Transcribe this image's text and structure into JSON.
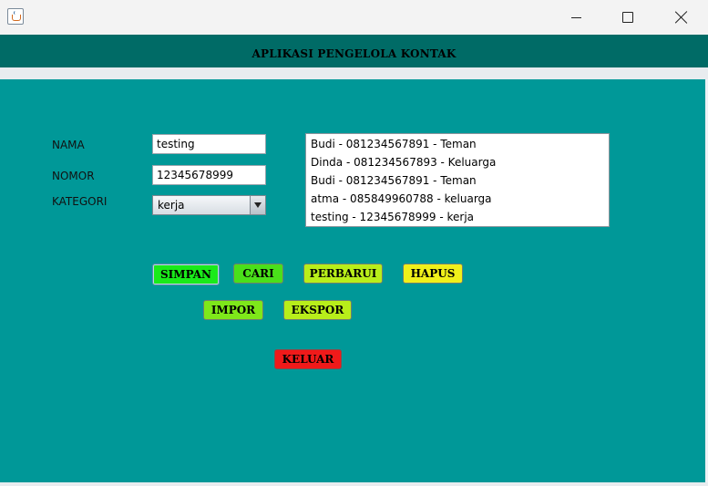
{
  "window": {
    "minimize_icon": "minimize-icon",
    "maximize_icon": "maximize-icon",
    "close_icon": "close-icon",
    "app_icon": "java-cup-icon"
  },
  "header": {
    "title": "APLIKASI PENGELOLA KONTAK"
  },
  "form": {
    "nama_label": "NAMA",
    "nama_value": "testing",
    "nomor_label": "NOMOR",
    "nomor_value": "12345678999",
    "kategori_label": "KATEGORI",
    "kategori_selected": "kerja"
  },
  "contacts": [
    "Budi - 081234567891 - Teman",
    "Dinda - 081234567893 - Keluarga",
    "Budi - 081234567891 - Teman",
    "atma - 085849960788 - keluarga",
    "testing - 12345678999 - kerja"
  ],
  "buttons": {
    "simpan": "SIMPAN",
    "cari": "CARI",
    "perbarui": "PERBARUI",
    "hapus": "HAPUS",
    "impor": "IMPOR",
    "ekspor": "EKSPOR",
    "keluar": "KELUAR"
  },
  "colors": {
    "header_bg": "#006b66",
    "panel_bg": "#009898",
    "simpan": "#1aea1a",
    "cari": "#4ae01a",
    "perbarui": "#b8ee1a",
    "hapus": "#f0f01a",
    "impor": "#7ee81a",
    "ekspor": "#b8ee1a",
    "keluar": "#f01a1a"
  }
}
